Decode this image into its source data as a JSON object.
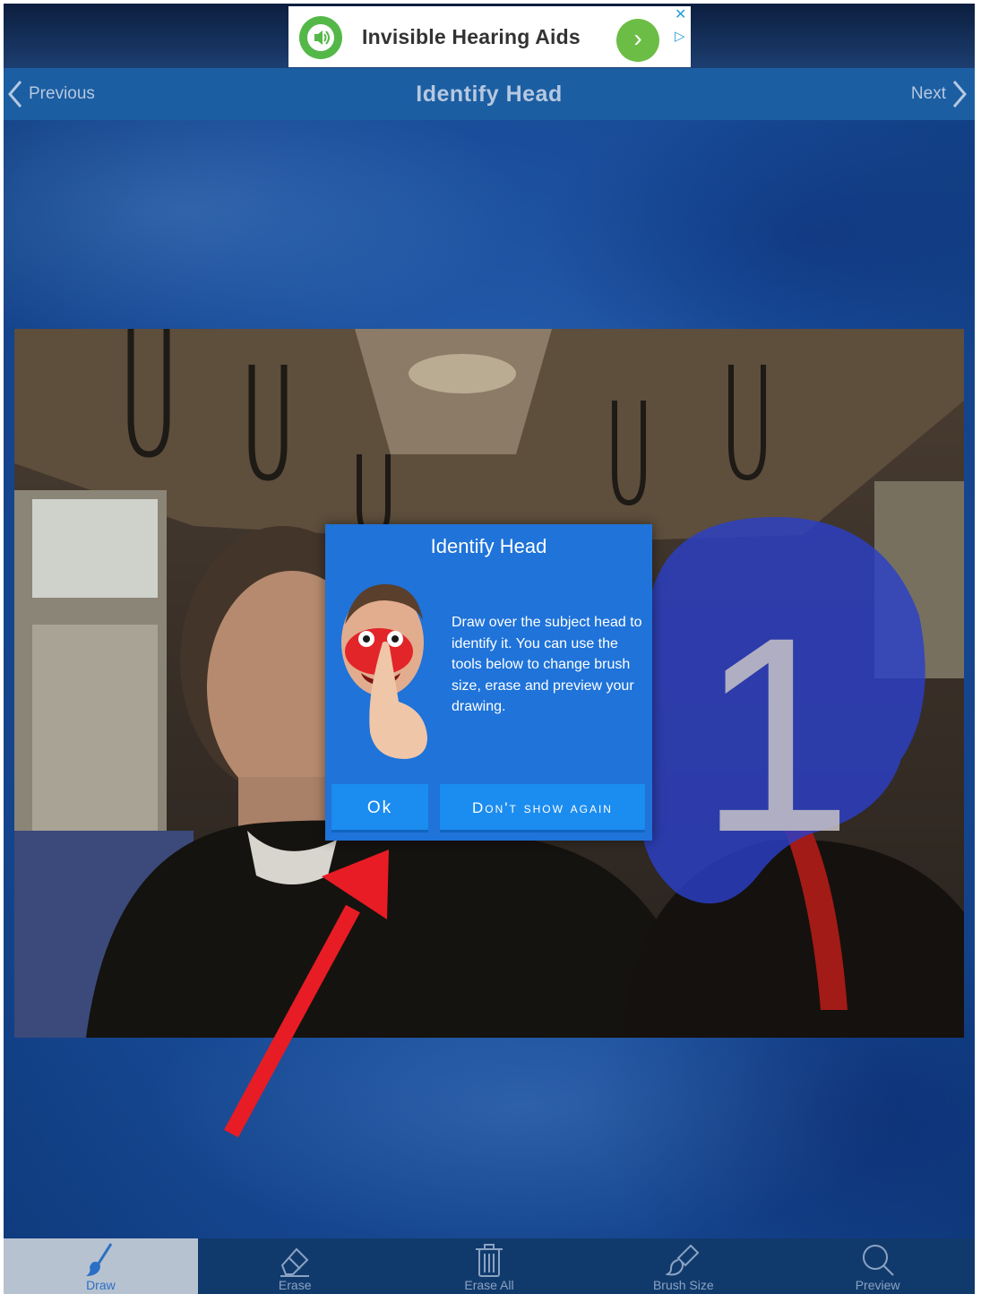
{
  "ad": {
    "title": "Invisible Hearing Aids",
    "go_icon": "chevron-right-icon",
    "close_icon": "close-icon",
    "choice_icon": "adchoices-icon"
  },
  "nav": {
    "previous_label": "Previous",
    "title": "Identify Head",
    "next_label": "Next"
  },
  "photo": {
    "subject_number": "1"
  },
  "dialog": {
    "title": "Identify Head",
    "body": "Draw over the subject head to identify it. You can use the tools below to change brush size, erase and preview your drawing.",
    "ok_label": "Ok",
    "dont_show_label": "Don't show again"
  },
  "toolbar": {
    "items": [
      {
        "label": "Draw",
        "icon": "brush-icon",
        "active": true
      },
      {
        "label": "Erase",
        "icon": "eraser-icon",
        "active": false
      },
      {
        "label": "Erase All",
        "icon": "trash-icon",
        "active": false
      },
      {
        "label": "Brush Size",
        "icon": "brush-size-icon",
        "active": false
      },
      {
        "label": "Preview",
        "icon": "magnifier-icon",
        "active": false
      }
    ]
  },
  "colors": {
    "nav_bar": "#1c5ea2",
    "dialog": "#1f73d9",
    "dialog_button": "#1b8cf0",
    "annotation_arrow": "#e81c24",
    "head_mask": "#2b3fc7"
  }
}
